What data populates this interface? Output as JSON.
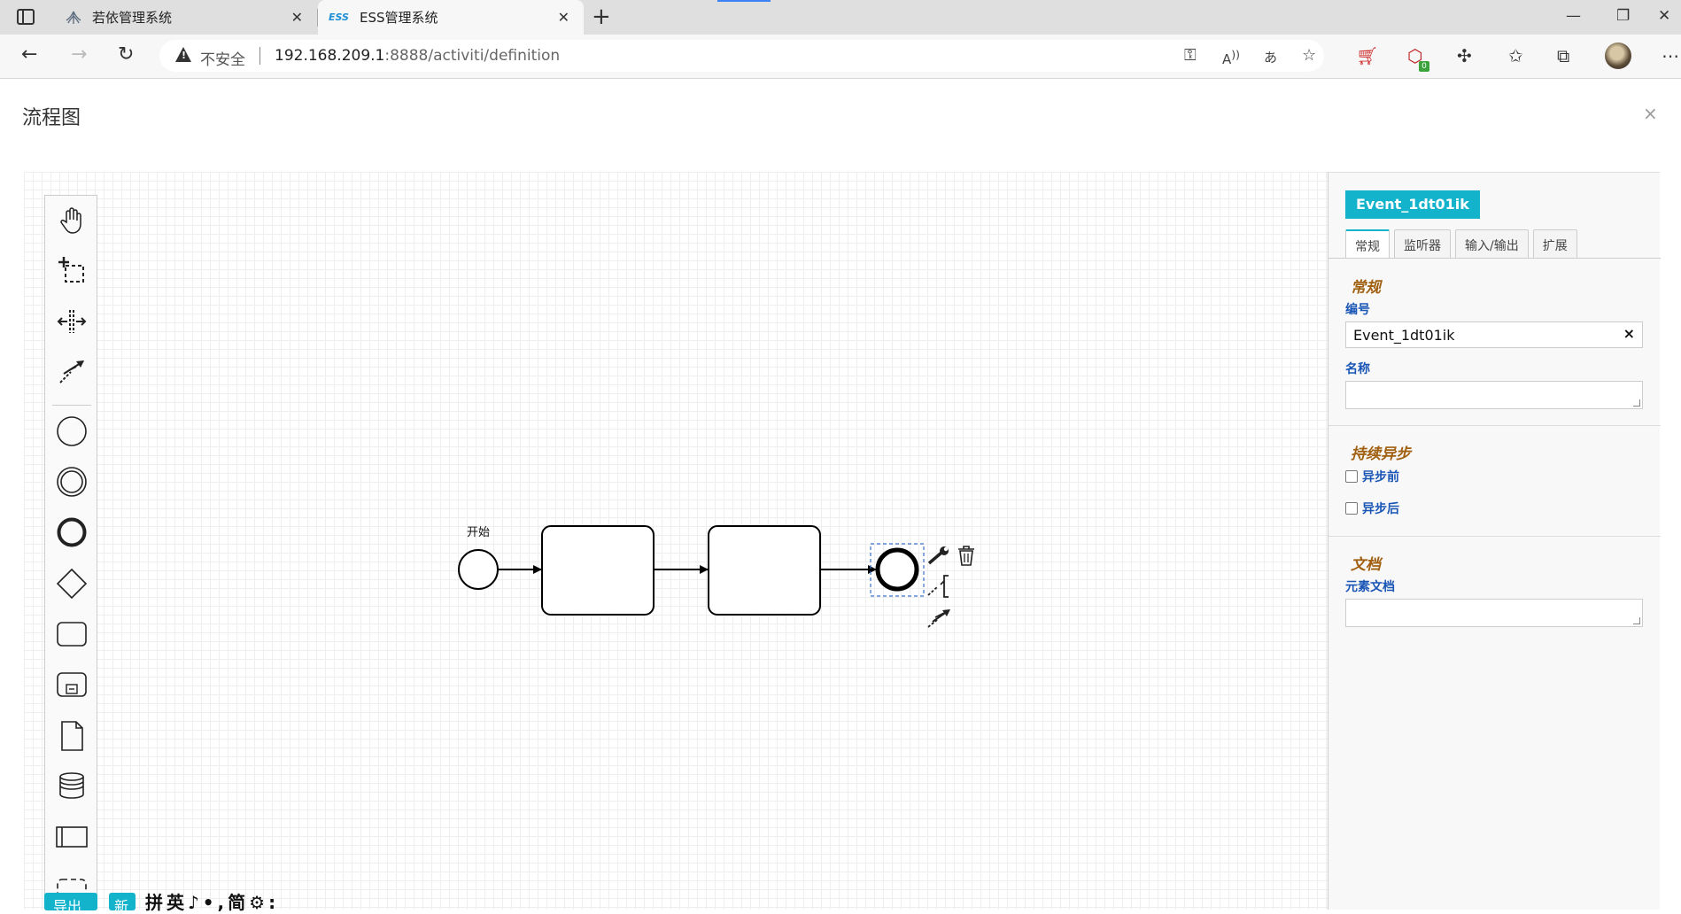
{
  "browser": {
    "tabs": [
      {
        "title": "若依管理系统",
        "favicon": "ruoyi-leaf-icon",
        "active": false
      },
      {
        "title": "ESS管理系统",
        "favicon_text": "ESS",
        "active": true
      }
    ],
    "security_label": "不安全",
    "url_host": "192.168.209.1",
    "url_rest": ":8888/activiti/definition",
    "extension_badge": "0"
  },
  "page": {
    "title": "流程图",
    "close_glyph": "×"
  },
  "palette": {
    "tools": [
      "hand-tool-icon",
      "lasso-tool-icon",
      "space-tool-icon",
      "global-connect-tool-icon",
      "start-event-icon",
      "intermediate-event-icon",
      "end-event-icon",
      "gateway-icon",
      "task-icon",
      "subprocess-icon",
      "data-object-icon",
      "data-store-icon",
      "pool-icon",
      "group-icon"
    ]
  },
  "diagram": {
    "start_label": "开始",
    "context_pad": [
      "wrench-icon",
      "trash-icon",
      "connect-icon",
      "arrow-connect-icon"
    ]
  },
  "bottom": {
    "export_label": "导出",
    "new_label": "新",
    "ime_text": "拼英♪•,简⚙:"
  },
  "properties": {
    "element_id": "Event_1dt01ik",
    "tabs": [
      "常规",
      "监听器",
      "输入/输出",
      "扩展"
    ],
    "general_title": "常规",
    "id_label": "编号",
    "id_value": "Event_1dt01ik",
    "id_clear": "×",
    "name_label": "名称",
    "async_title": "持续异步",
    "async_before": "异步前",
    "async_after": "异步后",
    "doc_title": "文档",
    "doc_label": "元素文档",
    "accent_color": "#14b3cc"
  }
}
